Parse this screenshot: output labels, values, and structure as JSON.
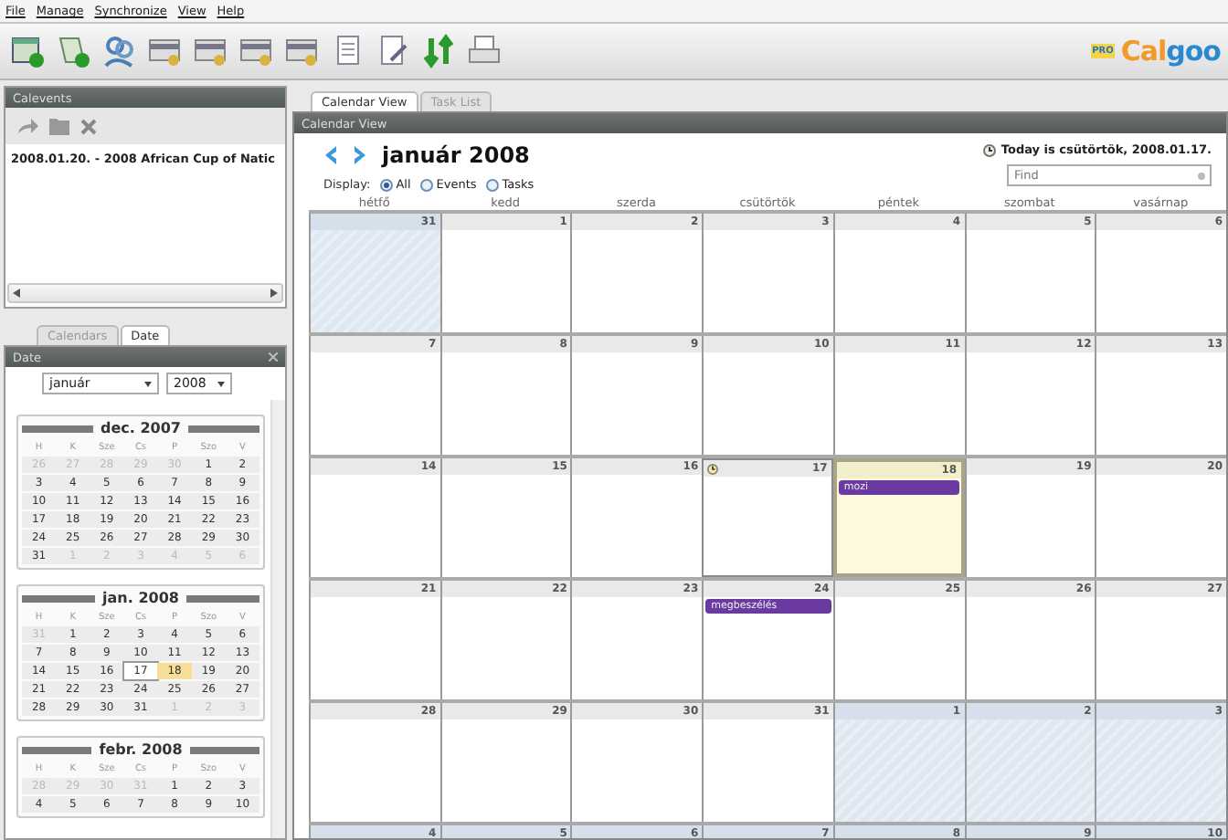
{
  "menu": [
    "File",
    "Manage",
    "Synchronize",
    "View",
    "Help"
  ],
  "toolbar": [
    {
      "kind": "calendar-add"
    },
    {
      "kind": "event-add"
    },
    {
      "kind": "people"
    },
    {
      "kind": "card"
    },
    {
      "kind": "card"
    },
    {
      "kind": "card"
    },
    {
      "kind": "card"
    },
    {
      "kind": "document"
    },
    {
      "kind": "document-edit"
    },
    {
      "kind": "sync"
    },
    {
      "kind": "printer"
    }
  ],
  "logo": {
    "badge": "PRO",
    "name_a": "Cal",
    "name_b": "goo"
  },
  "calevents": {
    "title": "Calevents",
    "items": [
      {
        "label": "2008.01.20. - 2008 African Cup of Natic",
        "selected": false
      }
    ]
  },
  "left_tabs": [
    {
      "label": "Calendars",
      "selected": false
    },
    {
      "label": "Date",
      "selected": true
    }
  ],
  "date_panel": {
    "title": "Date",
    "month": "január",
    "year": "2008",
    "months": [
      {
        "title": "dec. 2007",
        "weekdays": [
          "H",
          "K",
          "Sze",
          "Cs",
          "P",
          "Szo",
          "V"
        ],
        "weeks": [
          [
            {
              "day": "26",
              "kind": "muted"
            },
            {
              "day": "27",
              "kind": "muted"
            },
            {
              "day": "28",
              "kind": "muted"
            },
            {
              "day": "29",
              "kind": "muted"
            },
            {
              "day": "30",
              "kind": "muted"
            },
            {
              "day": "1",
              "kind": "normal"
            },
            {
              "day": "2",
              "kind": "normal"
            }
          ],
          [
            {
              "day": "3",
              "kind": "normal"
            },
            {
              "day": "4",
              "kind": "normal"
            },
            {
              "day": "5",
              "kind": "normal"
            },
            {
              "day": "6",
              "kind": "normal"
            },
            {
              "day": "7",
              "kind": "normal"
            },
            {
              "day": "8",
              "kind": "normal"
            },
            {
              "day": "9",
              "kind": "normal"
            }
          ],
          [
            {
              "day": "10",
              "kind": "normal"
            },
            {
              "day": "11",
              "kind": "normal"
            },
            {
              "day": "12",
              "kind": "normal"
            },
            {
              "day": "13",
              "kind": "normal"
            },
            {
              "day": "14",
              "kind": "normal"
            },
            {
              "day": "15",
              "kind": "normal"
            },
            {
              "day": "16",
              "kind": "normal"
            }
          ],
          [
            {
              "day": "17",
              "kind": "normal"
            },
            {
              "day": "18",
              "kind": "normal"
            },
            {
              "day": "19",
              "kind": "normal"
            },
            {
              "day": "20",
              "kind": "normal"
            },
            {
              "day": "21",
              "kind": "normal"
            },
            {
              "day": "22",
              "kind": "normal"
            },
            {
              "day": "23",
              "kind": "normal"
            }
          ],
          [
            {
              "day": "24",
              "kind": "normal"
            },
            {
              "day": "25",
              "kind": "normal"
            },
            {
              "day": "26",
              "kind": "normal"
            },
            {
              "day": "27",
              "kind": "normal"
            },
            {
              "day": "28",
              "kind": "normal"
            },
            {
              "day": "29",
              "kind": "normal"
            },
            {
              "day": "30",
              "kind": "normal"
            }
          ],
          [
            {
              "day": "31",
              "kind": "normal"
            },
            {
              "day": "1",
              "kind": "muted"
            },
            {
              "day": "2",
              "kind": "muted"
            },
            {
              "day": "3",
              "kind": "muted"
            },
            {
              "day": "4",
              "kind": "muted"
            },
            {
              "day": "5",
              "kind": "muted"
            },
            {
              "day": "6",
              "kind": "muted"
            }
          ]
        ]
      },
      {
        "title": "jan. 2008",
        "weekdays": [
          "H",
          "K",
          "Sze",
          "Cs",
          "P",
          "Szo",
          "V"
        ],
        "weeks": [
          [
            {
              "day": "31",
              "kind": "muted"
            },
            {
              "day": "1",
              "kind": "normal"
            },
            {
              "day": "2",
              "kind": "normal"
            },
            {
              "day": "3",
              "kind": "normal"
            },
            {
              "day": "4",
              "kind": "normal"
            },
            {
              "day": "5",
              "kind": "normal"
            },
            {
              "day": "6",
              "kind": "normal"
            }
          ],
          [
            {
              "day": "7",
              "kind": "normal"
            },
            {
              "day": "8",
              "kind": "normal"
            },
            {
              "day": "9",
              "kind": "normal"
            },
            {
              "day": "10",
              "kind": "normal"
            },
            {
              "day": "11",
              "kind": "normal"
            },
            {
              "day": "12",
              "kind": "normal"
            },
            {
              "day": "13",
              "kind": "normal"
            }
          ],
          [
            {
              "day": "14",
              "kind": "normal"
            },
            {
              "day": "15",
              "kind": "normal"
            },
            {
              "day": "16",
              "kind": "normal"
            },
            {
              "day": "17",
              "kind": "today"
            },
            {
              "day": "18",
              "kind": "selected"
            },
            {
              "day": "19",
              "kind": "normal"
            },
            {
              "day": "20",
              "kind": "normal"
            }
          ],
          [
            {
              "day": "21",
              "kind": "normal"
            },
            {
              "day": "22",
              "kind": "normal"
            },
            {
              "day": "23",
              "kind": "normal"
            },
            {
              "day": "24",
              "kind": "normal"
            },
            {
              "day": "25",
              "kind": "normal"
            },
            {
              "day": "26",
              "kind": "normal"
            },
            {
              "day": "27",
              "kind": "normal"
            }
          ],
          [
            {
              "day": "28",
              "kind": "normal"
            },
            {
              "day": "29",
              "kind": "normal"
            },
            {
              "day": "30",
              "kind": "normal"
            },
            {
              "day": "31",
              "kind": "normal"
            },
            {
              "day": "1",
              "kind": "muted"
            },
            {
              "day": "2",
              "kind": "muted"
            },
            {
              "day": "3",
              "kind": "muted"
            }
          ]
        ]
      },
      {
        "title": "febr. 2008",
        "weekdays": [
          "H",
          "K",
          "Sze",
          "Cs",
          "P",
          "Szo",
          "V"
        ],
        "weeks": [
          [
            {
              "day": "28",
              "kind": "muted"
            },
            {
              "day": "29",
              "kind": "muted"
            },
            {
              "day": "30",
              "kind": "muted"
            },
            {
              "day": "31",
              "kind": "muted"
            },
            {
              "day": "1",
              "kind": "normal"
            },
            {
              "day": "2",
              "kind": "normal"
            },
            {
              "day": "3",
              "kind": "normal"
            }
          ],
          [
            {
              "day": "4",
              "kind": "normal"
            },
            {
              "day": "5",
              "kind": "normal"
            },
            {
              "day": "6",
              "kind": "normal"
            },
            {
              "day": "7",
              "kind": "normal"
            },
            {
              "day": "8",
              "kind": "normal"
            },
            {
              "day": "9",
              "kind": "normal"
            },
            {
              "day": "10",
              "kind": "normal"
            }
          ]
        ]
      }
    ]
  },
  "main_tabs": [
    {
      "label": "Calendar View",
      "selected": true
    },
    {
      "label": "Task List",
      "selected": false
    }
  ],
  "calendar_view": {
    "title": "Calendar View",
    "month_title": "január 2008",
    "today_text": "Today is csütörtök, 2008.01.17.",
    "find_placeholder": "Find",
    "display_label": "Display:",
    "display_options": [
      {
        "label": "All",
        "selected": true
      },
      {
        "label": "Events",
        "selected": false
      },
      {
        "label": "Tasks",
        "selected": false
      }
    ],
    "weekdays": [
      "hétfő",
      "kedd",
      "szerda",
      "csütörtök",
      "péntek",
      "szombat",
      "vasárnap"
    ],
    "weeks": [
      [
        {
          "day": "31",
          "kind": "muted"
        },
        {
          "day": "1",
          "kind": "normal"
        },
        {
          "day": "2",
          "kind": "normal"
        },
        {
          "day": "3",
          "kind": "normal"
        },
        {
          "day": "4",
          "kind": "normal"
        },
        {
          "day": "5",
          "kind": "normal"
        },
        {
          "day": "6",
          "kind": "normal"
        }
      ],
      [
        {
          "day": "7",
          "kind": "normal"
        },
        {
          "day": "8",
          "kind": "normal"
        },
        {
          "day": "9",
          "kind": "normal"
        },
        {
          "day": "10",
          "kind": "normal"
        },
        {
          "day": "11",
          "kind": "normal"
        },
        {
          "day": "12",
          "kind": "normal"
        },
        {
          "day": "13",
          "kind": "normal"
        }
      ],
      [
        {
          "day": "14",
          "kind": "normal"
        },
        {
          "day": "15",
          "kind": "normal"
        },
        {
          "day": "16",
          "kind": "normal"
        },
        {
          "day": "17",
          "kind": "today"
        },
        {
          "day": "18",
          "kind": "selected",
          "events": [
            "mozi"
          ]
        },
        {
          "day": "19",
          "kind": "normal"
        },
        {
          "day": "20",
          "kind": "normal"
        }
      ],
      [
        {
          "day": "21",
          "kind": "normal"
        },
        {
          "day": "22",
          "kind": "normal"
        },
        {
          "day": "23",
          "kind": "normal"
        },
        {
          "day": "24",
          "kind": "normal",
          "events": [
            "megbeszélés"
          ]
        },
        {
          "day": "25",
          "kind": "normal"
        },
        {
          "day": "26",
          "kind": "normal"
        },
        {
          "day": "27",
          "kind": "normal"
        }
      ],
      [
        {
          "day": "28",
          "kind": "normal"
        },
        {
          "day": "29",
          "kind": "normal"
        },
        {
          "day": "30",
          "kind": "normal"
        },
        {
          "day": "31",
          "kind": "normal"
        },
        {
          "day": "1",
          "kind": "muted"
        },
        {
          "day": "2",
          "kind": "muted"
        },
        {
          "day": "3",
          "kind": "muted"
        }
      ],
      [
        {
          "day": "4",
          "kind": "muted"
        },
        {
          "day": "5",
          "kind": "muted"
        },
        {
          "day": "6",
          "kind": "muted"
        },
        {
          "day": "7",
          "kind": "muted"
        },
        {
          "day": "8",
          "kind": "muted"
        },
        {
          "day": "9",
          "kind": "muted"
        },
        {
          "day": "10",
          "kind": "muted"
        }
      ]
    ]
  }
}
